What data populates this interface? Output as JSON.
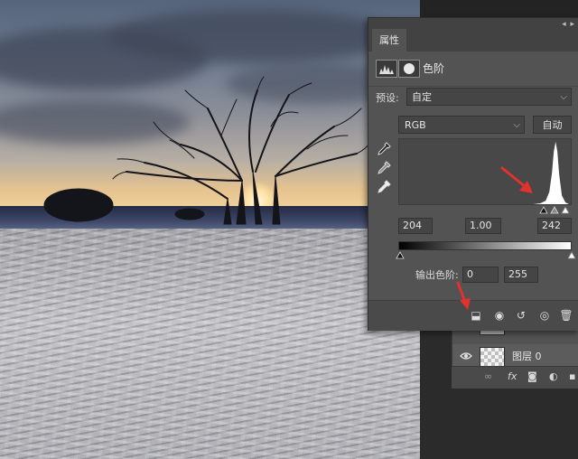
{
  "properties_panel": {
    "tab_label": "属性",
    "panel_menu": "◂ ▸",
    "adjustment_type": "色阶",
    "preset_label": "预设:",
    "preset_value": "自定",
    "channel_value": "RGB",
    "auto_label": "自动",
    "input_black": "204",
    "input_gamma": "1.00",
    "input_white": "242",
    "output_label": "输出色阶:",
    "output_black": "0",
    "output_white": "255"
  },
  "layers_panel": {
    "layers": [
      {
        "name": "图层 0",
        "visible": true,
        "selected": true
      }
    ],
    "footer_icons": [
      "link-icon",
      "fx-icon",
      "add-mask-icon",
      "adjustment-icon",
      "new-layer-icon"
    ]
  },
  "colors": {
    "panel_bg": "#535353",
    "panel_header": "#424242",
    "annotation_arrow": "#e1322d"
  },
  "icons": {
    "eyedroppers": [
      "black-point-eyedropper-icon",
      "gray-point-eyedropper-icon",
      "white-point-eyedropper-icon"
    ],
    "footer": [
      "clip-to-layer-icon",
      "view-previous-icon",
      "reset-icon",
      "visibility-icon",
      "delete-icon"
    ]
  }
}
